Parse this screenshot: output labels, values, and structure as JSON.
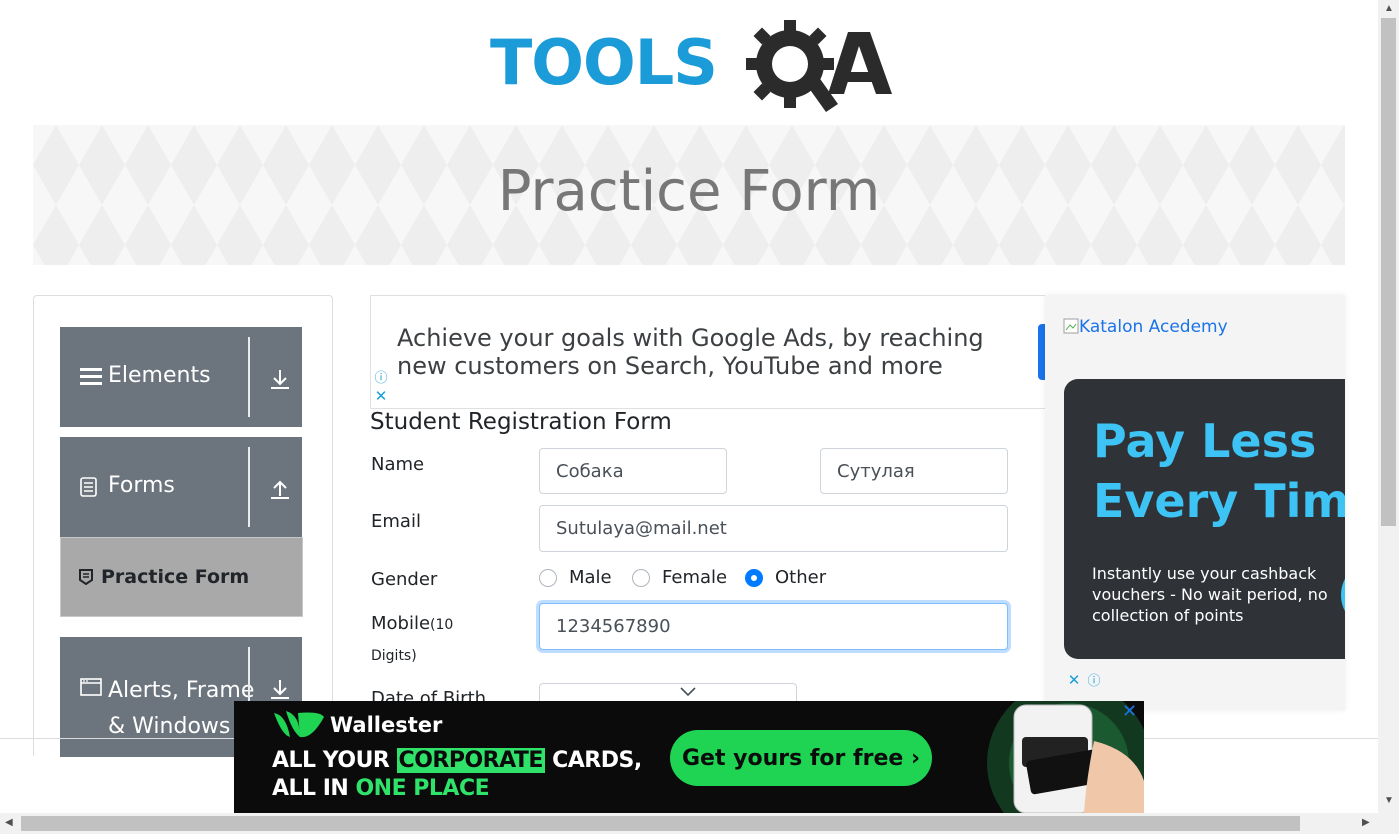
{
  "header": {
    "logo_text": "TOOLSQA",
    "logo_part1": "TOOLS",
    "logo_part2": "QA"
  },
  "banner": {
    "title": "Practice Form"
  },
  "sidebar": {
    "groups": [
      {
        "label": "Elements",
        "icon": "hamburger-icon",
        "arrow": "download-arrow-icon"
      },
      {
        "label": "Forms",
        "icon": "document-icon",
        "arrow": "upload-arrow-icon"
      },
      {
        "label": "Alerts, Frame & Windows",
        "label_line1": "Alerts, Frame",
        "label_line2": "& Windows",
        "icon": "window-icon",
        "arrow": "download-arrow-icon"
      }
    ],
    "active_item": {
      "label": "Practice Form",
      "icon": "form-icon"
    }
  },
  "google_ad": {
    "text": "Achieve your goals with Google Ads, by reaching new customers on Search, YouTube and more"
  },
  "form": {
    "title": "Student Registration Form",
    "name_label": "Name",
    "first_name": "Собака",
    "last_name": "Сутулая",
    "email_label": "Email",
    "email": "Sutulaya@mail.net",
    "gender_label": "Gender",
    "gender_options": [
      "Male",
      "Female",
      "Other"
    ],
    "gender_selected": "Other",
    "mobile_label": "Mobile",
    "mobile_hint": "(10",
    "mobile_hint2": "Digits)",
    "mobile": "1234567890",
    "dob_label": "Date of Birth"
  },
  "right_ad": {
    "broken_image_alt": "Katalon Acedemy",
    "headline1": "Pay Less",
    "headline2": "Every Time",
    "body": "Instantly use your cashback vouchers - No wait period, no collection of points"
  },
  "bottom_ad": {
    "brand": "Wallester",
    "line1_a": "ALL YOUR ",
    "line1_b": "CORPORATE",
    "line1_c": " CARDS,",
    "line2_a": "ALL IN ",
    "line2_b": "ONE PLACE",
    "cta": "Get yours for free ›"
  },
  "colors": {
    "brand_blue": "#1b9bd7",
    "sidebar_gray": "#6c757d",
    "active_gray": "#a9a9a9",
    "radio_blue": "#007bff",
    "ad_cyan": "#3dc3f4",
    "ad_green": "#1fd452"
  }
}
